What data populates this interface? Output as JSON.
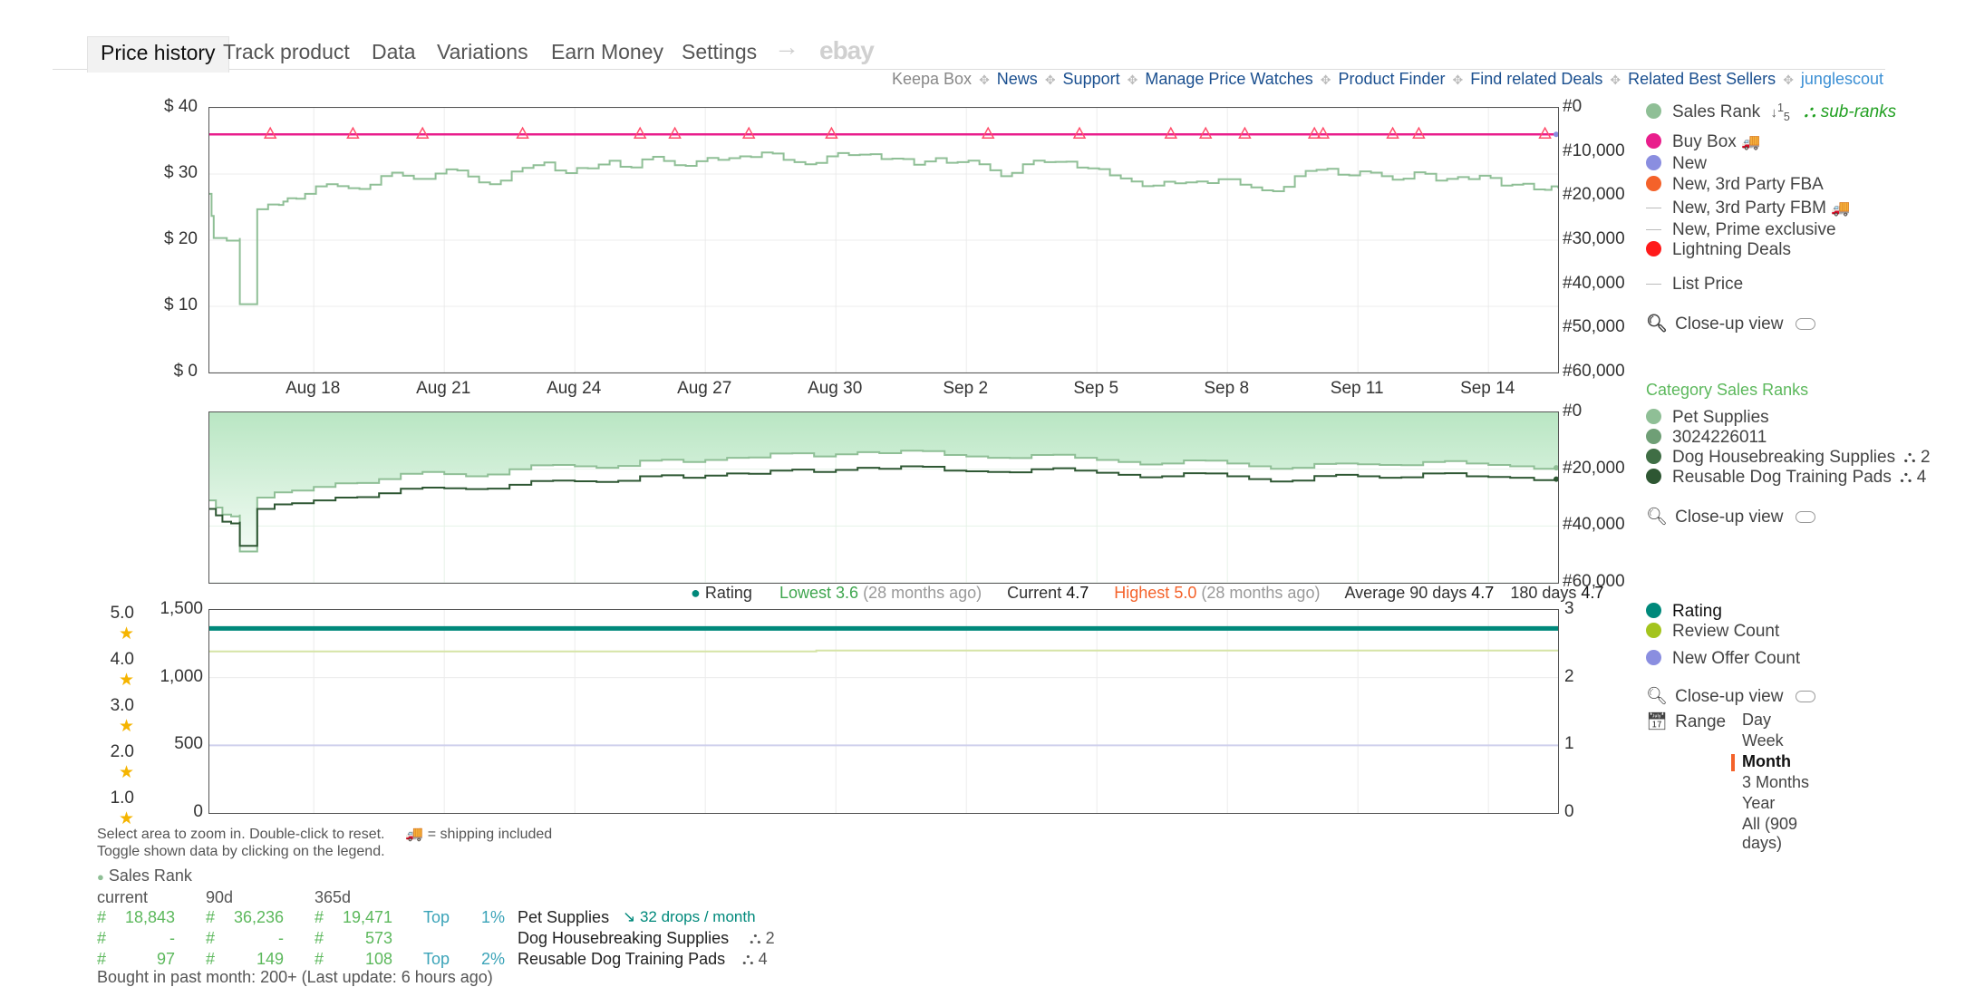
{
  "tabs": [
    "Price history",
    "Track product",
    "Data",
    "Variations",
    "Earn Money",
    "Settings"
  ],
  "ebay_label": "ebay",
  "links": {
    "keepa_box": "Keepa Box",
    "items": [
      "News",
      "Support",
      "Manage Price Watches",
      "Product Finder",
      "Find related Deals",
      "Related Best Sellers"
    ],
    "junglescout": "junglescout"
  },
  "chart_data": [
    {
      "type": "line",
      "name": "price-and-rank",
      "x_ticks": [
        "Aug 18",
        "Aug 21",
        "Aug 24",
        "Aug 27",
        "Aug 30",
        "Sep 2",
        "Sep 5",
        "Sep 8",
        "Sep 11",
        "Sep 14"
      ],
      "y_left_ticks": [
        "$ 40",
        "$ 30",
        "$ 20",
        "$ 10",
        "$ 0"
      ],
      "y_right_ticks": [
        "#0",
        "#10,000",
        "#20,000",
        "#30,000",
        "#40,000",
        "#50,000",
        "#60,000"
      ],
      "ylim_left": [
        0,
        40
      ],
      "ylim_right": [
        60000,
        0
      ],
      "x_range_days": [
        15.6,
        46.6
      ],
      "buy_box_price": 36,
      "buy_box_markers_day": [
        17,
        18.9,
        20.5,
        22.8,
        25.5,
        26.3,
        28,
        29.9,
        33.5,
        35.6,
        37.7,
        38.5,
        39.4,
        41,
        41.2,
        42.8,
        43.4,
        46.3
      ],
      "sales_rank": [
        [
          15.6,
          19500
        ],
        [
          15.7,
          29500
        ],
        [
          16.3,
          29500
        ],
        [
          16.3,
          44500
        ],
        [
          16.7,
          44500
        ],
        [
          16.7,
          23000
        ],
        [
          17.2,
          22000
        ],
        [
          17.4,
          20500
        ],
        [
          17.8,
          19500
        ],
        [
          18.3,
          17300
        ],
        [
          18.8,
          18200
        ],
        [
          19.3,
          17400
        ],
        [
          19.8,
          14700
        ],
        [
          20.3,
          16100
        ],
        [
          20.8,
          14900
        ],
        [
          21.3,
          14200
        ],
        [
          21.8,
          16900
        ],
        [
          22.3,
          16500
        ],
        [
          22.8,
          13600
        ],
        [
          23.3,
          12400
        ],
        [
          23.8,
          14800
        ],
        [
          24.3,
          13700
        ],
        [
          24.8,
          12000
        ],
        [
          25.3,
          13500
        ],
        [
          25.8,
          11100
        ],
        [
          26.3,
          13000
        ],
        [
          26.8,
          12100
        ],
        [
          27.3,
          11800
        ],
        [
          27.8,
          11000
        ],
        [
          28.3,
          10100
        ],
        [
          28.8,
          11800
        ],
        [
          29.3,
          12800
        ],
        [
          29.8,
          11000
        ],
        [
          30.3,
          10700
        ],
        [
          30.8,
          10500
        ],
        [
          31.3,
          11500
        ],
        [
          31.8,
          12900
        ],
        [
          32.3,
          11400
        ],
        [
          32.8,
          12300
        ],
        [
          33.3,
          12800
        ],
        [
          33.8,
          15500
        ],
        [
          34.3,
          12800
        ],
        [
          34.8,
          12300
        ],
        [
          35.3,
          12200
        ],
        [
          35.8,
          13700
        ],
        [
          36.3,
          15300
        ],
        [
          36.8,
          16700
        ],
        [
          37.3,
          17600
        ],
        [
          37.8,
          17100
        ],
        [
          38.3,
          16700
        ],
        [
          38.8,
          16200
        ],
        [
          39.3,
          17400
        ],
        [
          39.8,
          18700
        ],
        [
          40.3,
          17900
        ],
        [
          40.8,
          14300
        ],
        [
          41.3,
          13800
        ],
        [
          41.8,
          15300
        ],
        [
          42.3,
          14700
        ],
        [
          42.8,
          16300
        ],
        [
          43.3,
          14600
        ],
        [
          43.8,
          16500
        ],
        [
          44.3,
          15700
        ],
        [
          44.8,
          15400
        ],
        [
          45.3,
          17600
        ],
        [
          45.8,
          17200
        ],
        [
          46.3,
          18600
        ],
        [
          46.6,
          18200
        ]
      ]
    },
    {
      "type": "area",
      "name": "category-sales-ranks",
      "y_right_ticks": [
        "#0",
        "#20,000",
        "#40,000",
        "#60,000"
      ],
      "ylim": [
        60000,
        0
      ],
      "series": [
        {
          "name": "Pet Supplies",
          "values": [
            [
              15.6,
              31000
            ],
            [
              15.9,
              36000
            ],
            [
              16.3,
              36000
            ],
            [
              16.3,
              49000
            ],
            [
              16.7,
              49000
            ],
            [
              16.7,
              30000
            ],
            [
              17.5,
              27500
            ],
            [
              18.5,
              25000
            ],
            [
              19.5,
              23500
            ],
            [
              20.5,
              21000
            ],
            [
              21.5,
              22500
            ],
            [
              22.5,
              20000
            ],
            [
              23.5,
              18500
            ],
            [
              24.5,
              19500
            ],
            [
              25.5,
              17000
            ],
            [
              26.5,
              17500
            ],
            [
              27.5,
              16000
            ],
            [
              28.5,
              14500
            ],
            [
              29.5,
              15500
            ],
            [
              30.5,
              14000
            ],
            [
              31.5,
              13500
            ],
            [
              32.5,
              15000
            ],
            [
              33.5,
              16000
            ],
            [
              34.5,
              15000
            ],
            [
              35.5,
              16000
            ],
            [
              36.5,
              17500
            ],
            [
              37.5,
              18000
            ],
            [
              38.5,
              17000
            ],
            [
              39.5,
              19000
            ],
            [
              40.5,
              19500
            ],
            [
              41.5,
              18000
            ],
            [
              42.5,
              18500
            ],
            [
              43.5,
              17500
            ],
            [
              44.5,
              18000
            ],
            [
              45.5,
              19000
            ],
            [
              46.6,
              19500
            ]
          ]
        },
        {
          "name": "Reusable Dog Training Pads",
          "values": [
            [
              15.6,
              34000
            ],
            [
              15.9,
              38500
            ],
            [
              16.3,
              38500
            ],
            [
              16.3,
              47000
            ],
            [
              16.7,
              47000
            ],
            [
              16.7,
              34000
            ],
            [
              17.5,
              32000
            ],
            [
              18.5,
              30000
            ],
            [
              19.5,
              28500
            ],
            [
              20.5,
              26500
            ],
            [
              21.5,
              27000
            ],
            [
              22.5,
              25500
            ],
            [
              23.5,
              24000
            ],
            [
              24.5,
              24500
            ],
            [
              25.5,
              22500
            ],
            [
              26.5,
              23000
            ],
            [
              27.5,
              21500
            ],
            [
              28.5,
              20500
            ],
            [
              29.5,
              21000
            ],
            [
              30.5,
              19500
            ],
            [
              31.5,
              19000
            ],
            [
              32.5,
              20500
            ],
            [
              33.5,
              21000
            ],
            [
              34.5,
              20000
            ],
            [
              35.5,
              20500
            ],
            [
              36.5,
              22000
            ],
            [
              37.5,
              22500
            ],
            [
              38.5,
              21500
            ],
            [
              39.5,
              23500
            ],
            [
              40.5,
              24000
            ],
            [
              41.5,
              22000
            ],
            [
              42.5,
              23000
            ],
            [
              43.5,
              21500
            ],
            [
              44.5,
              22500
            ],
            [
              45.5,
              23000
            ],
            [
              46.6,
              23500
            ]
          ]
        }
      ]
    },
    {
      "type": "line",
      "name": "rating-and-review-count",
      "y_star_ticks": [
        "5.0",
        "4.0",
        "3.0",
        "2.0",
        "1.0"
      ],
      "y_left_ticks": [
        "1,500",
        "1,000",
        "500",
        "0"
      ],
      "y_right_ticks": [
        "3",
        "2",
        "1",
        "0"
      ],
      "ylim_left": [
        0,
        1500
      ],
      "ylim_right": [
        0,
        3
      ],
      "rating": 4.7,
      "review_count": 1200,
      "new_offer_count": 1
    }
  ],
  "rating_bar": {
    "label": "Rating",
    "lowest_label": "Lowest",
    "lowest": "3.6",
    "lowest_when": "(28 months ago)",
    "current_label": "Current",
    "current": "4.7",
    "highest_label": "Highest",
    "highest": "5.0",
    "highest_when": "(28 months ago)",
    "avg90_label": "Average 90 days",
    "avg90": "4.7",
    "avg180_label": "180 days",
    "avg180": "4.7"
  },
  "legend_top": {
    "sales_rank": "Sales Rank",
    "sales_rank_sort": "1̲5",
    "sub_ranks": "sub-ranks",
    "buy_box": "Buy Box",
    "new": "New",
    "new_fba": "New, 3rd Party FBA",
    "new_fbm": "New, 3rd Party FBM",
    "new_prime": "New, Prime exclusive",
    "lightning": "Lightning Deals",
    "list_price": "List Price",
    "closeup": "Close-up view",
    "colors": {
      "sales_rank": "#8fbf96",
      "buy_box": "#e91e8c",
      "new": "#8a8ee0",
      "new_fba": "#f4622a",
      "lightning": "#ff1a1a"
    }
  },
  "legend_mid": {
    "title": "Category Sales Ranks",
    "items": [
      {
        "label": "Pet Supplies",
        "color": "#8fbf96",
        "count": ""
      },
      {
        "label": "3024226011",
        "color": "#6f9f76",
        "count": ""
      },
      {
        "label": "Dog Housebreaking Supplies",
        "color": "#3f6e45",
        "count": "2"
      },
      {
        "label": "Reusable Dog Training Pads",
        "color": "#2e5733",
        "count": "4"
      }
    ],
    "closeup": "Close-up view"
  },
  "legend_bot": {
    "rating": "Rating",
    "review_count": "Review Count",
    "new_offer_count": "New Offer Count",
    "closeup": "Close-up view",
    "range_label": "Range",
    "ranges": [
      "Day",
      "Week",
      "Month",
      "3 Months",
      "Year",
      "All (909 days)"
    ],
    "selected_range": "Month",
    "colors": {
      "rating": "#00897b",
      "review_count": "#a4c41e",
      "new_offer_count": "#8a8ee0"
    }
  },
  "help": {
    "line1": "Select area to zoom in. Double-click to reset.",
    "shipping": "= shipping included",
    "line2": "Toggle shown data by clicking on the legend."
  },
  "sales_table": {
    "title": "Sales Rank",
    "headers": [
      "current",
      "90d",
      "365d"
    ],
    "rows": [
      {
        "current": "18,843",
        "d90": "36,236",
        "d365": "19,471",
        "top": "Top",
        "pct": "1%",
        "category": "Pet Supplies",
        "extra": "32 drops / month",
        "count": ""
      },
      {
        "current": "-",
        "d90": "-",
        "d365": "573",
        "top": "",
        "pct": "",
        "category": "Dog Housebreaking Supplies",
        "extra": "",
        "count": "2"
      },
      {
        "current": "97",
        "d90": "149",
        "d365": "108",
        "top": "Top",
        "pct": "2%",
        "category": "Reusable Dog Training Pads",
        "extra": "",
        "count": "4"
      }
    ],
    "bought": "Bought in past month: 200+ (Last update: 6 hours ago)"
  }
}
